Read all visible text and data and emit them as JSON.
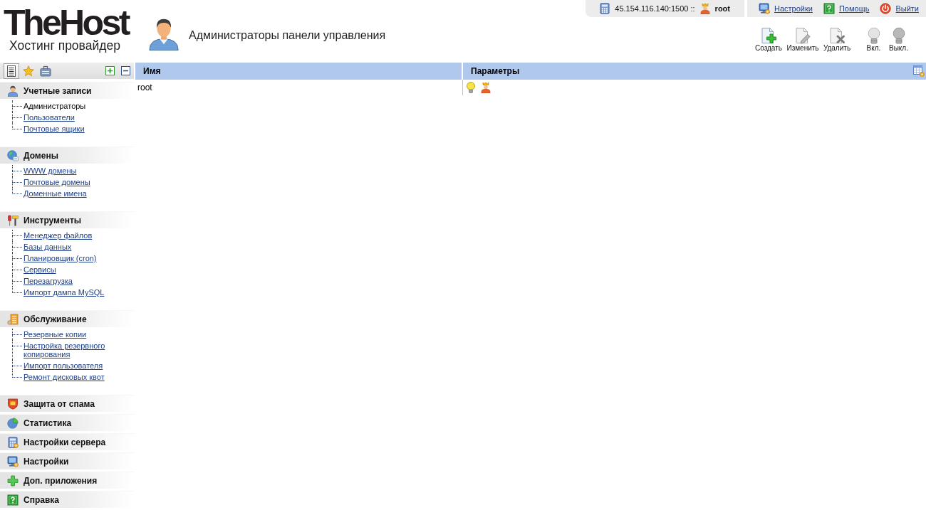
{
  "logo": {
    "title": "TheHost",
    "subtitle": "Хостинг провайдер"
  },
  "page_title": "Администраторы панели управления",
  "server_info": {
    "address": "45.154.116.140:1500 ::",
    "user": "root"
  },
  "top_links": [
    {
      "kind": "settings",
      "label": "Настройки"
    },
    {
      "kind": "help",
      "label": "Помощь"
    },
    {
      "kind": "logout",
      "label": "Выйти"
    }
  ],
  "toolbar": [
    {
      "kind": "create",
      "label": "Создать",
      "disabled": false
    },
    {
      "kind": "edit",
      "label": "Изменить",
      "disabled": true
    },
    {
      "kind": "delete",
      "label": "Удалить",
      "disabled": true
    },
    {
      "kind": "on",
      "label": "Вкл.",
      "disabled": true
    },
    {
      "kind": "off",
      "label": "Выкл.",
      "disabled": true
    }
  ],
  "sidebar": {
    "tabs": [
      {
        "kind": "tree",
        "selected": true
      },
      {
        "kind": "favorites",
        "selected": false
      },
      {
        "kind": "tasks",
        "selected": false
      }
    ],
    "sections": [
      {
        "kind": "accounts",
        "title": "Учетные записи",
        "items": [
          {
            "label": "Администраторы",
            "selected": true
          },
          {
            "label": "Пользователи",
            "selected": false
          },
          {
            "label": "Почтовые ящики",
            "selected": false
          }
        ]
      },
      {
        "kind": "domains",
        "title": "Домены",
        "items": [
          {
            "label": "WWW домены",
            "selected": false
          },
          {
            "label": "Почтовые домены",
            "selected": false
          },
          {
            "label": "Доменные имена",
            "selected": false
          }
        ]
      },
      {
        "kind": "tools",
        "title": "Инструменты",
        "items": [
          {
            "label": "Менеджер файлов",
            "selected": false
          },
          {
            "label": "Базы данных",
            "selected": false
          },
          {
            "label": "Планировщик (cron)",
            "selected": false
          },
          {
            "label": "Сервисы",
            "selected": false
          },
          {
            "label": "Перезагрузка",
            "selected": false
          },
          {
            "label": "Импорт дампа MySQL",
            "selected": false
          }
        ]
      },
      {
        "kind": "maintenance",
        "title": "Обслуживание",
        "items": [
          {
            "label": "Резервные копии",
            "selected": false
          },
          {
            "label": "Настройка резервного копирования",
            "selected": false
          },
          {
            "label": "Импорт пользователя",
            "selected": false
          },
          {
            "label": "Ремонт дисковых квот",
            "selected": false
          }
        ]
      },
      {
        "kind": "antispam",
        "title": "Защита от спама"
      },
      {
        "kind": "stats",
        "title": "Статистика"
      },
      {
        "kind": "server",
        "title": "Настройки сервера"
      },
      {
        "kind": "settings",
        "title": "Настройки"
      },
      {
        "kind": "apps",
        "title": "Доп. приложения"
      },
      {
        "kind": "help",
        "title": "Справка"
      }
    ]
  },
  "table": {
    "columns": [
      "Имя",
      "Параметры"
    ],
    "rows": [
      {
        "name": "root",
        "enabled": true,
        "superuser": true
      }
    ]
  }
}
